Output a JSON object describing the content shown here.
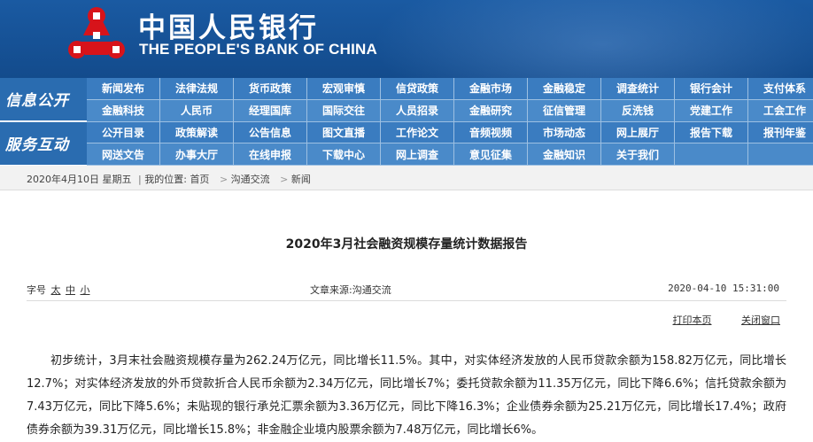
{
  "brand": {
    "name_cn": "中国人民银行",
    "name_en": "THE PEOPLE'S BANK OF CHINA",
    "emblem_icon": "pboc-emblem-icon",
    "colors": {
      "header_blue": "#1a5aa2",
      "nav_blue": "#3a7cc0",
      "emblem_red": "#d7131a"
    }
  },
  "nav": {
    "section1_label": "信息公开",
    "section2_label": "服务互动",
    "row1": [
      "新闻发布",
      "法律法规",
      "货币政策",
      "宏观审慎",
      "信贷政策",
      "金融市场",
      "金融稳定",
      "调查统计",
      "银行会计",
      "支付体系"
    ],
    "row2": [
      "金融科技",
      "人民币",
      "经理国库",
      "国际交往",
      "人员招录",
      "金融研究",
      "征信管理",
      "反洗钱",
      "党建工作",
      "工会工作"
    ],
    "row3": [
      "公开目录",
      "政策解读",
      "公告信息",
      "图文直播",
      "工作论文",
      "音频视频",
      "市场动态",
      "网上展厅",
      "报告下载",
      "报刊年鉴"
    ],
    "row4": [
      "网送文告",
      "办事大厅",
      "在线申报",
      "下载中心",
      "网上调查",
      "意见征集",
      "金融知识",
      "关于我们"
    ]
  },
  "breadcrumb": {
    "date": "2020年4月10日",
    "weekday": "星期五",
    "location_label": "我的位置:",
    "items": [
      "首页",
      "沟通交流",
      "新闻"
    ]
  },
  "article": {
    "title": "2020年3月社会融资规模存量统计数据报告",
    "font_size_label": "字号",
    "font_size_options": [
      "太",
      "中",
      "小"
    ],
    "source_label": "文章来源:",
    "source": "沟通交流",
    "datetime": "2020-04-10 15:31:00",
    "print_label": "打印本页",
    "close_label": "关闭窗口",
    "body": "初步统计，3月末社会融资规模存量为262.24万亿元，同比增长11.5%。其中，对实体经济发放的人民币贷款余额为158.82万亿元，同比增长12.7%；对实体经济发放的外币贷款折合人民币余额为2.34万亿元，同比增长7%；委托贷款余额为11.35万亿元，同比下降6.6%；信托贷款余额为7.43万亿元，同比下降5.6%；未贴现的银行承兑汇票余额为3.36万亿元，同比下降16.3%；企业债券余额为25.21万亿元，同比增长17.4%；政府债券余额为39.31万亿元，同比增长15.8%；非金融企业境内股票余额为7.48万亿元，同比增长6%。"
  }
}
